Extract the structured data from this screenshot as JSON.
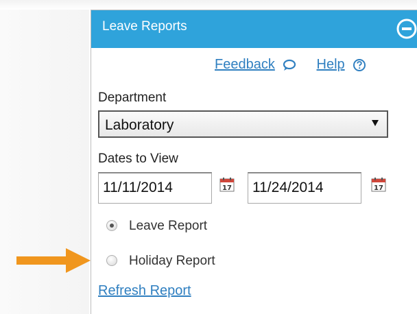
{
  "panel": {
    "title": "Leave Reports",
    "header_color": "#2fa3db",
    "collapse_icon": "minus-circle-icon"
  },
  "links": {
    "feedback_label": "Feedback",
    "feedback_icon": "speech-bubble-icon",
    "help_label": "Help",
    "help_icon": "question-circle-icon",
    "link_color": "#2f7fc0"
  },
  "department": {
    "label": "Department",
    "selected": "Laboratory"
  },
  "dates": {
    "label": "Dates to View",
    "start": "11/11/2014",
    "end": "11/24/2014",
    "calendar_icon": "calendar-icon",
    "calendar_day": "17"
  },
  "report_type": {
    "options": [
      {
        "label": "Leave Report",
        "checked": true
      },
      {
        "label": "Holiday Report",
        "checked": false
      }
    ]
  },
  "actions": {
    "refresh_label": "Refresh Report"
  },
  "annotation": {
    "arrow_color": "#f0961e",
    "arrow_icon": "arrow-right-icon"
  }
}
